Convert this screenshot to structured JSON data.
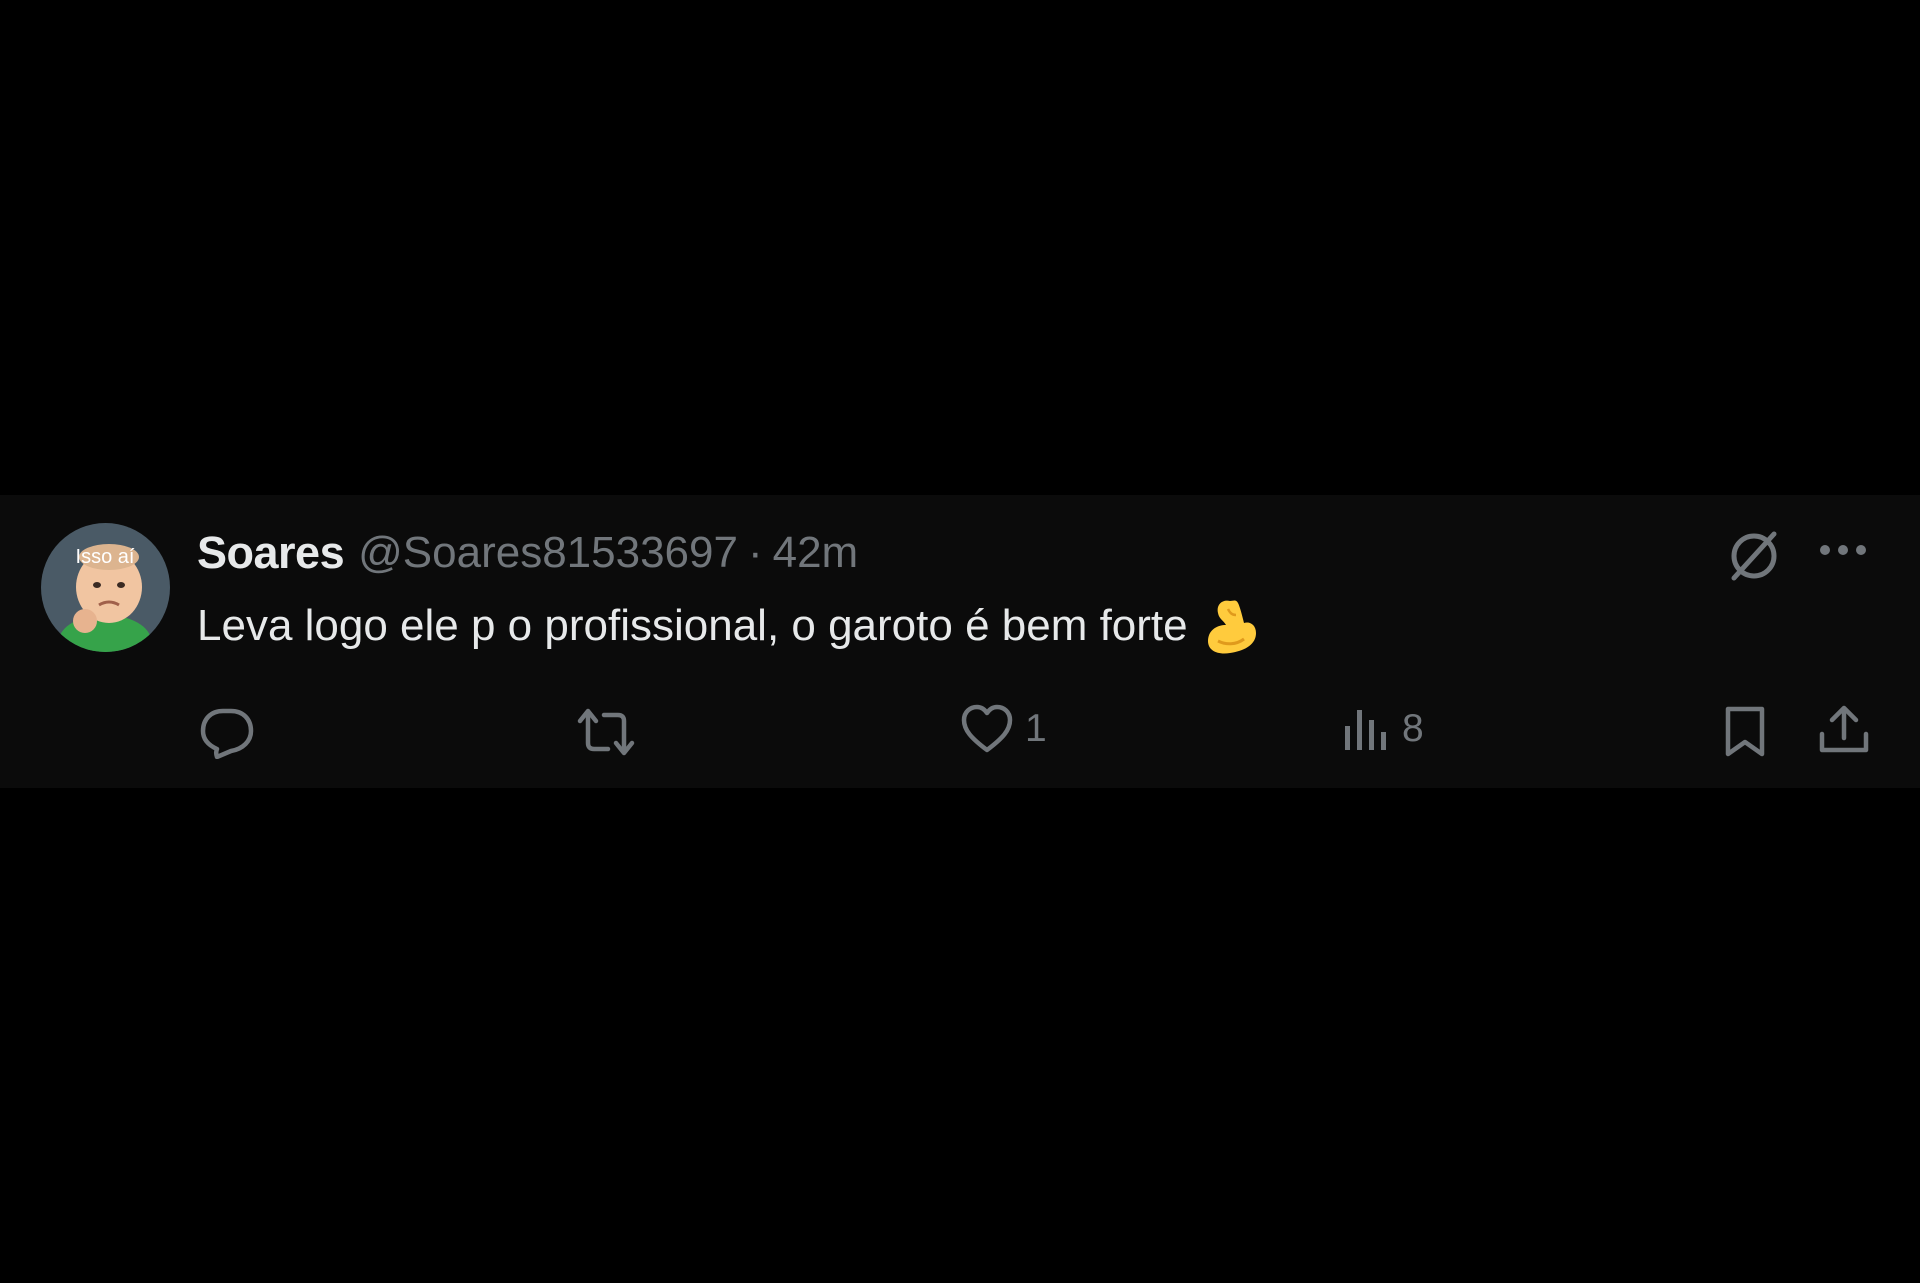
{
  "tweet": {
    "display_name": "Soares",
    "handle": "@Soares81533697",
    "separator": "·",
    "time": "42m",
    "text": "Leva logo ele p o profissional, o garoto é bem forte",
    "avatar_caption": "Isso aí",
    "emoji": "flexed-biceps-emoji"
  },
  "actions": {
    "reply": {
      "icon": "reply-icon"
    },
    "retweet": {
      "icon": "retweet-icon"
    },
    "like": {
      "icon": "heart-icon",
      "count": "1"
    },
    "views": {
      "icon": "views-icon",
      "count": "8"
    },
    "bookmark": {
      "icon": "bookmark-icon"
    },
    "share": {
      "icon": "share-icon"
    },
    "grok": {
      "icon": "grok-icon"
    },
    "more": {
      "icon": "more-icon"
    }
  },
  "colors": {
    "background": "#000000",
    "tweet_background": "#0b0b0b",
    "primary_text": "#e7e9ea",
    "secondary_text": "#71767b"
  }
}
